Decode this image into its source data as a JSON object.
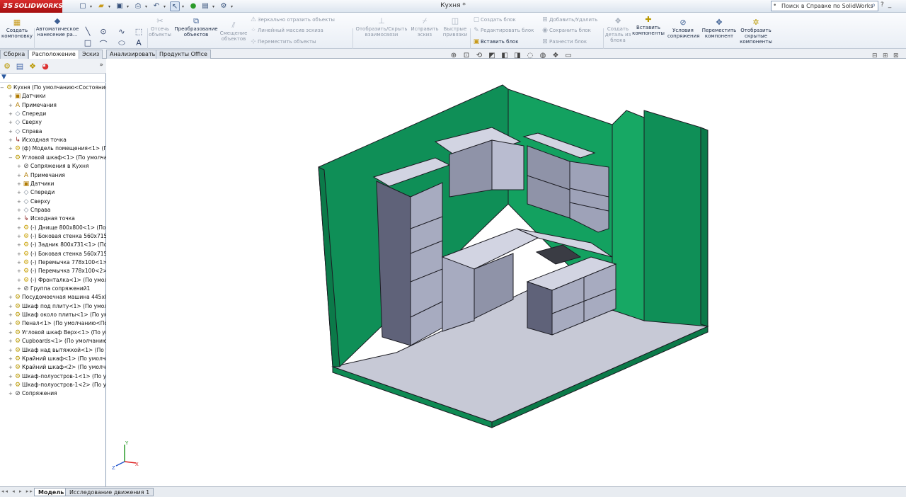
{
  "app": {
    "brand": "SOLIDWORKS",
    "brand_prefix": "3S",
    "document_title": "Кухня *",
    "search_placeholder": "Поиск в Справке по SolidWorks"
  },
  "toolbar": {
    "create_layout": "Создать компоновку",
    "auto_dimension": "Автоматическое нанесение ра...",
    "trim_entities": "Отсечь объекты",
    "convert_entities": "Преобразование объектов",
    "offset_entities": "Смещение объектов",
    "mirror_entities": "Зеркально отразить объекты",
    "linear_pattern": "Линейный массив эскиза",
    "move_entities": "Переместить объекты",
    "show_hide_relations": "Отобразить/Скрыть взаимосвязи",
    "repair_sketch": "Исправить эскиз",
    "quick_snaps": "Быстрые привязки",
    "make_block": "Создать блок",
    "edit_block": "Редактировать блок",
    "insert_block": "Вставить блок",
    "add_remove": "Добавить/Удалить",
    "save_block": "Сохранить блок",
    "explode_block": "Разнести блок",
    "make_part_from_block": "Создать деталь из блока",
    "insert_components": "Вставить компоненты",
    "mate_conditions": "Условия сопряжения",
    "move_component": "Переместить компонент",
    "show_hidden_components": "Отобразить скрытые компоненты"
  },
  "tabs": [
    {
      "label": "Сборка"
    },
    {
      "label": "Расположение"
    },
    {
      "label": "Эскиз"
    },
    {
      "label": "Анализировать"
    },
    {
      "label": "Продукты Office"
    }
  ],
  "tree": [
    {
      "label": "Кухня  (По умолчанию<Состояние",
      "icon": "assembly-icon",
      "expanded": true
    },
    {
      "label": "Датчики",
      "icon": "sensor-icon"
    },
    {
      "label": "Примечания",
      "icon": "annotations-icon"
    },
    {
      "label": "Спереди",
      "icon": "plane-icon"
    },
    {
      "label": "Сверху",
      "icon": "plane-icon"
    },
    {
      "label": "Справа",
      "icon": "plane-icon"
    },
    {
      "label": "Исходная точка",
      "icon": "origin-icon"
    },
    {
      "label": "(ф) Модель помещения<1> (По",
      "icon": "part-icon"
    },
    {
      "label": "Угловой шкаф<1> (По умолчан",
      "icon": "subassembly-icon",
      "expanded": true
    },
    {
      "label": "Сопряжения в Кухня",
      "icon": "mates-icon"
    },
    {
      "label": "Примечания",
      "icon": "annotations-icon"
    },
    {
      "label": "Датчики",
      "icon": "sensor-icon"
    },
    {
      "label": "Спереди",
      "icon": "plane-icon"
    },
    {
      "label": "Сверху",
      "icon": "plane-icon"
    },
    {
      "label": "Справа",
      "icon": "plane-icon"
    },
    {
      "label": "Исходная точка",
      "icon": "origin-icon"
    },
    {
      "label": "(-) Днище 800x800<1> (По ум",
      "icon": "part-icon"
    },
    {
      "label": "(-) Боковая стенка 560x715<1",
      "icon": "part-icon"
    },
    {
      "label": "(-) Задник 800x731<1> (По ум",
      "icon": "part-icon"
    },
    {
      "label": "(-) Боковая стенка 560x715<3",
      "icon": "part-icon"
    },
    {
      "label": "(-) Перемычка 778x100<1> (П",
      "icon": "part-icon"
    },
    {
      "label": "(-) Перемычка 778x100<2> (П",
      "icon": "part-icon"
    },
    {
      "label": "(-) Фронталка<1> (По умолч",
      "icon": "part-icon"
    },
    {
      "label": "Группа сопряжений1",
      "icon": "mates-icon"
    },
    {
      "label": "Посудомоечная машина 445x82",
      "icon": "subassembly-icon"
    },
    {
      "label": "Шкаф под плиту<1> (По умолча",
      "icon": "subassembly-icon"
    },
    {
      "label": "Шкаф около плиты<1> (По умол",
      "icon": "subassembly-icon"
    },
    {
      "label": "Пенал<1> (По умолчанию<По",
      "icon": "subassembly-icon"
    },
    {
      "label": "Угловой шкаф Верх<1> (По умо",
      "icon": "subassembly-icon"
    },
    {
      "label": "Cupboards<1> (По умолчанию<",
      "icon": "subassembly-icon"
    },
    {
      "label": "Шкаф над вытяжкой<1> (По ум",
      "icon": "subassembly-icon"
    },
    {
      "label": "Крайний шкаф<1> (По умолчан",
      "icon": "subassembly-icon"
    },
    {
      "label": "Крайний шкаф<2> (По умолчан",
      "icon": "subassembly-icon"
    },
    {
      "label": "Шкаф-полуостров-1<1> (По ум",
      "icon": "subassembly-icon"
    },
    {
      "label": "Шкаф-полуостров-1<2> (По ум",
      "icon": "subassembly-icon"
    },
    {
      "label": "Сопряжения",
      "icon": "mates-icon"
    }
  ],
  "bottom_tabs": [
    {
      "label": "Модель"
    },
    {
      "label": "Исследование движения 1"
    }
  ],
  "colors": {
    "wall_green": "#0f8f57",
    "wall_green_light": "#19a866",
    "floor": "#c7c9d6",
    "cabinet_face": "#b9bcd0",
    "cabinet_dark": "#6b6f86",
    "edge": "#1b1b22"
  }
}
